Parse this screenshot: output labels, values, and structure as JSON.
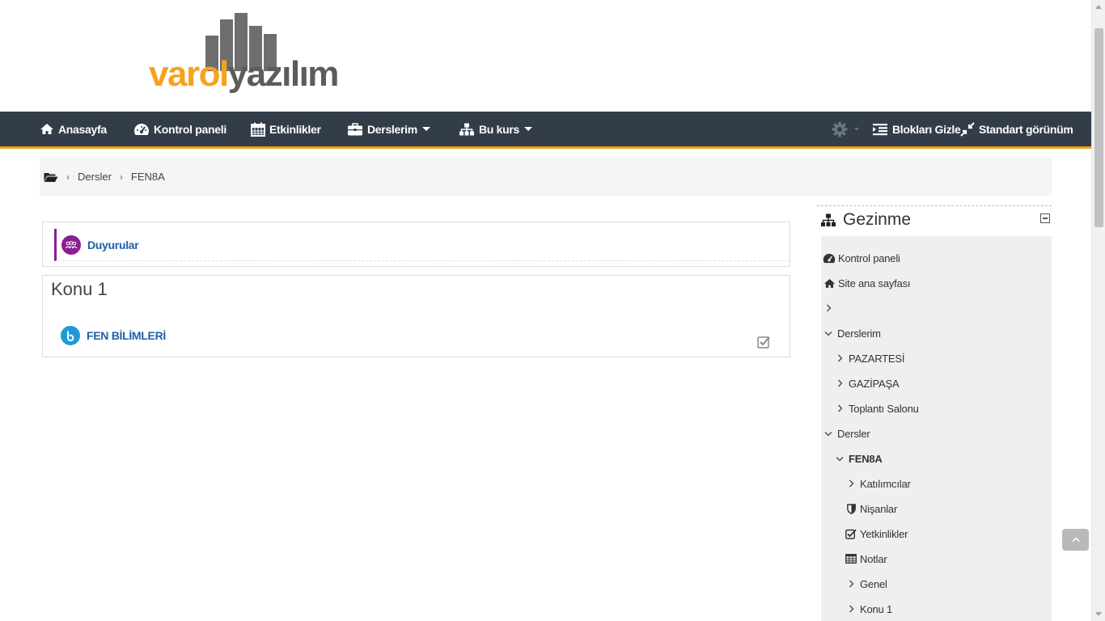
{
  "logo": {
    "part1": "varol",
    "part2": "yazılım"
  },
  "navbar": {
    "items": [
      {
        "label": "Anasayfa",
        "icon": "home-icon"
      },
      {
        "label": "Kontrol paneli",
        "icon": "dashboard-icon"
      },
      {
        "label": "Etkinlikler",
        "icon": "calendar-icon"
      },
      {
        "label": "Derslerim",
        "icon": "briefcase-icon"
      },
      {
        "label": "Bu kurs",
        "icon": "sitemap-icon"
      }
    ],
    "right": [
      {
        "label": "Blokları Gizle",
        "icon": "indent-icon"
      },
      {
        "label": "Standart görünüm",
        "icon": "compress-icon"
      }
    ]
  },
  "breadcrumb": {
    "items": [
      "Dersler",
      "FEN8A"
    ]
  },
  "main": {
    "announcements": {
      "label": "Duyurular"
    },
    "section": {
      "title": "Konu 1",
      "activity": "FEN BİLİMLERİ"
    }
  },
  "navigation_block": {
    "title": "Gezinme",
    "items": [
      {
        "label": "Kontrol paneli"
      },
      {
        "label": "Site ana sayfası"
      },
      {
        "label": ""
      },
      {
        "label": "Derslerim"
      },
      {
        "label": "PAZARTESİ"
      },
      {
        "label": "GAZİPAŞA"
      },
      {
        "label": "Toplantı Salonu"
      },
      {
        "label": "Dersler"
      },
      {
        "label": "FEN8A"
      },
      {
        "label": "Katılımcılar"
      },
      {
        "label": "Nişanlar"
      },
      {
        "label": "Yetkinlikler"
      },
      {
        "label": "Notlar"
      },
      {
        "label": "Genel"
      },
      {
        "label": "Konu 1"
      }
    ]
  },
  "colors": {
    "navbar": "#333d4a",
    "accent": "#e6a117",
    "link": "#1f5faa",
    "forum": "#8a1f8f",
    "bbb": "#1d9ad6"
  }
}
